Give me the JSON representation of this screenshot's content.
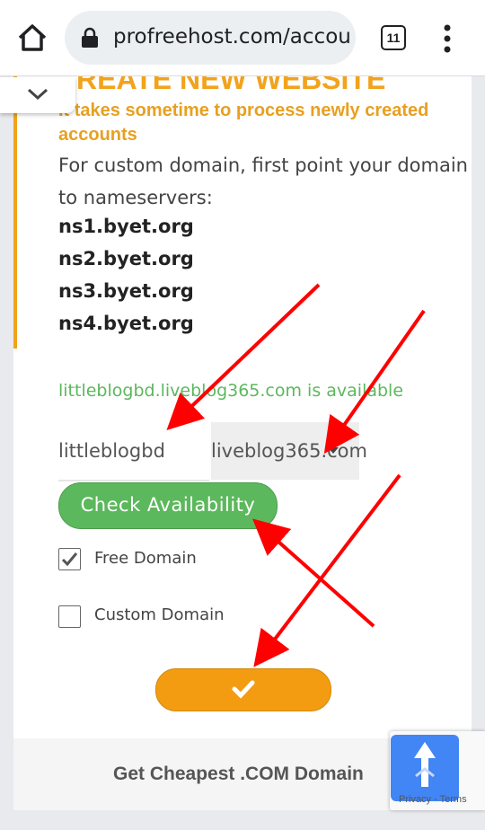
{
  "browser": {
    "url": "profreehost.com/accou",
    "tab_count": "11"
  },
  "page": {
    "heading_partial": "REATE NEW WEBSITE",
    "warning": "It takes sometime to process newly created accounts",
    "info": "For custom domain, first point your domain to nameservers:",
    "nameservers": [
      "ns1.byet.org",
      "ns2.byet.org",
      "ns3.byet.org",
      "ns4.byet.org"
    ],
    "availability_message": "littleblogbd.liveblog365.com is available",
    "subdomain_value": "littleblogbd",
    "domain_select_value": "liveblog365.com",
    "check_button": "Check Availability",
    "free_domain_label": "Free Domain",
    "free_domain_checked": true,
    "custom_domain_label": "Custom Domain",
    "custom_domain_checked": false,
    "footer_text": "Get Cheapest .COM Domain",
    "recaptcha_terms": "Privacy - Terms"
  },
  "colors": {
    "accent_orange": "#f2a31c",
    "success_green": "#5cb85c",
    "submit_orange": "#f39c12",
    "annotation_red": "#ff0000"
  }
}
